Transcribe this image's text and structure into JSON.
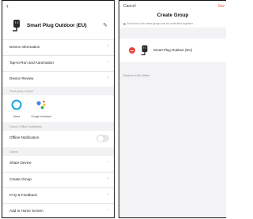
{
  "left": {
    "back_glyph": "‹",
    "device_name": "Smart Plug Outdoor (EU)",
    "edit_icon": "pencil-icon",
    "rows_top": [
      "Device Information",
      "Tap-to-Run and Automation",
      "Device Review"
    ],
    "section_third_party": "Third-party Control",
    "third_party": [
      {
        "name": "Alexa",
        "icon": "alexa-icon"
      },
      {
        "name": "Google Assistant",
        "icon": "google-assistant-icon"
      }
    ],
    "section_offline": "Device Offline Notification",
    "offline_label": "Offline Notification",
    "offline_enabled": false,
    "section_others": "Others",
    "rows_bottom": [
      "Share Device",
      "Create Group",
      "FAQ & Feedback",
      "Add to Home Screen"
    ]
  },
  "right": {
    "cancel": "Cancel",
    "save": "Sav",
    "title": "Create Group",
    "note": "Devices in the same group can be controlled together.",
    "members": [
      {
        "name": "Smart Plug Outdoor (EU)"
      }
    ],
    "to_add": "Devices to Be Added"
  },
  "colors": {
    "accent": "#ff5a28",
    "remove": "#e8413a",
    "alexa": "#1aa3e0",
    "section_bg": "#f2f2f4"
  }
}
